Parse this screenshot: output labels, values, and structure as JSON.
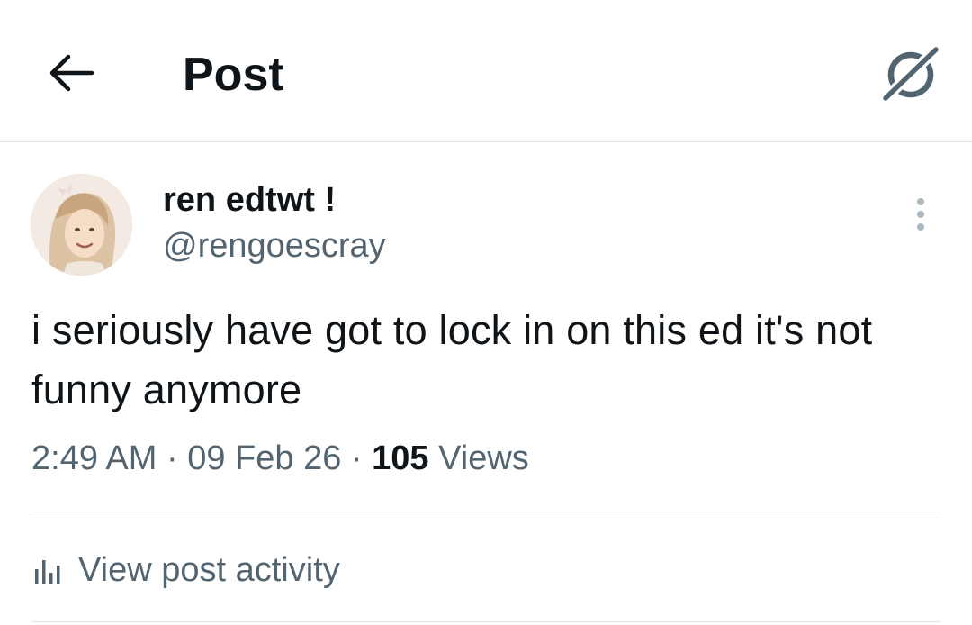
{
  "header": {
    "title": "Post",
    "back_icon": "arrow-left-icon",
    "grok_icon": "grok-icon"
  },
  "author": {
    "display_name": "ren edtwt !",
    "handle": "@rengoescray"
  },
  "post": {
    "text": "i seriously have got to lock in on this ed it's not funny anymore",
    "time": "2:49 AM",
    "date": "09 Feb 26",
    "separator": "·",
    "views_count": "105",
    "views_label": "Views"
  },
  "activity": {
    "label": "View post activity",
    "icon": "bar-chart-icon"
  },
  "colors": {
    "text_primary": "#0f1419",
    "text_secondary": "#536471",
    "divider": "#e2e5e8"
  }
}
